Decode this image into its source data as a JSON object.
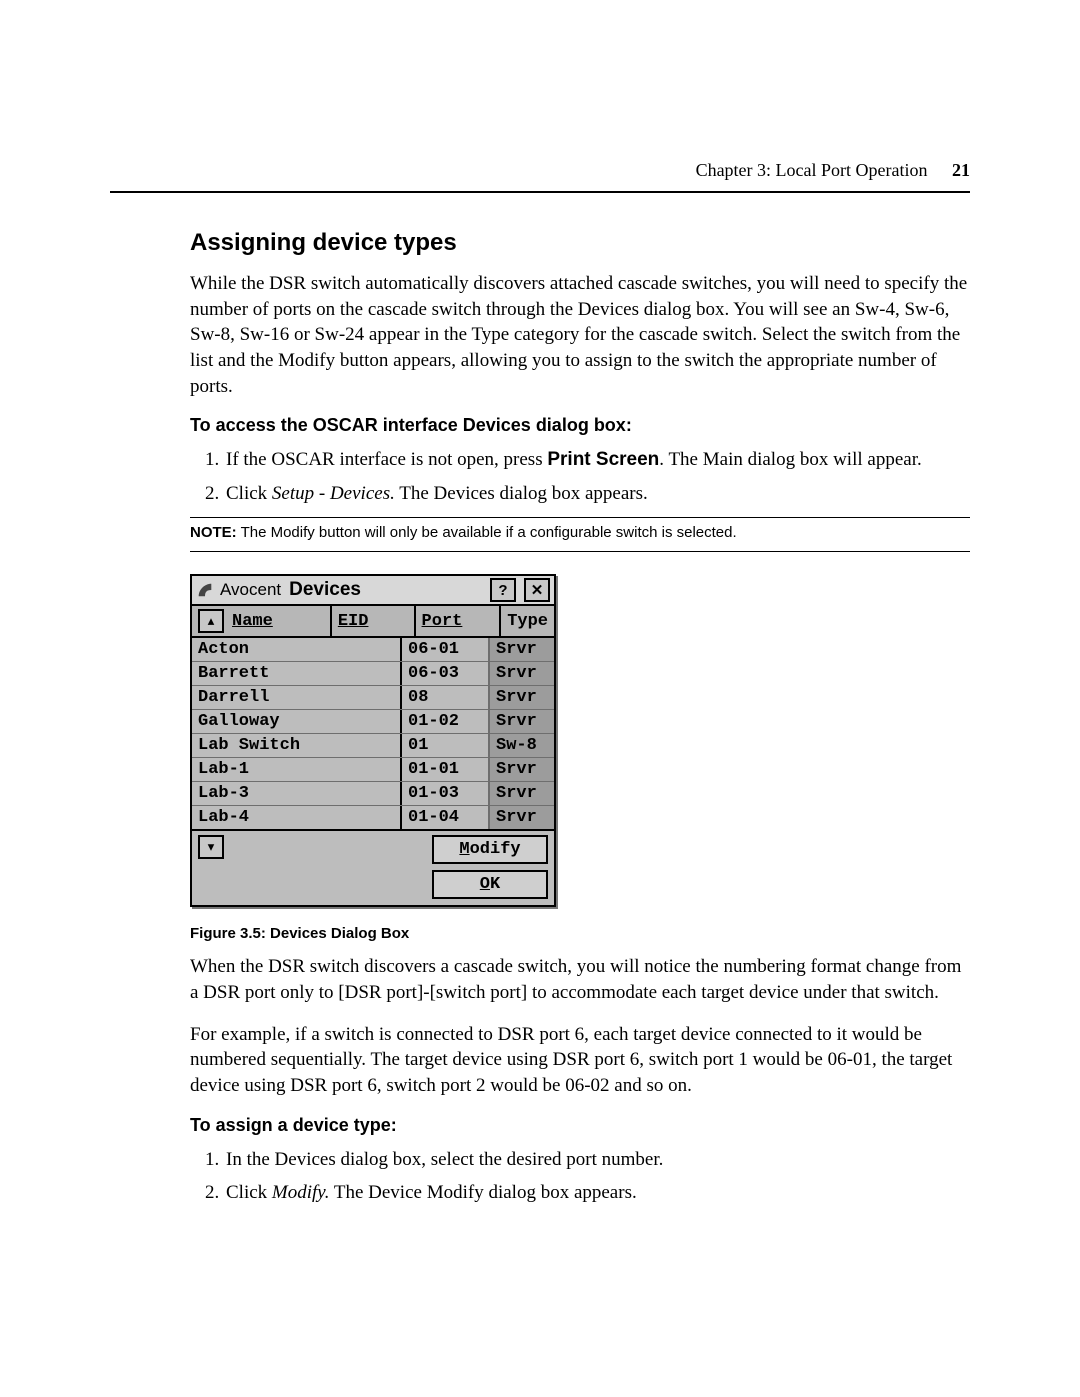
{
  "header": {
    "chapter": "Chapter 3: Local Port Operation",
    "page_number": "21"
  },
  "section_title": "Assigning device types",
  "intro_paragraph": "While the DSR switch automatically discovers attached cascade switches, you will need to specify the number of ports on the cascade switch through the Devices dialog box. You will see an Sw-4, Sw-6, Sw-8, Sw-16 or Sw-24 appear in the Type category for the cascade switch. Select the switch from the list and the Modify button appears, allowing you to assign to the switch the appropriate number of ports.",
  "access_heading": "To access the OSCAR interface Devices dialog box:",
  "access_steps": {
    "s1_pre": "If the OSCAR interface is not open, press ",
    "s1_bold": "Print Screen",
    "s1_post": ". The Main dialog box will appear.",
    "s2_pre": "Click ",
    "s2_italic": "Setup - Devices.",
    "s2_post": " The Devices dialog box appears."
  },
  "note_label": "NOTE:",
  "note_text": " The Modify button will only be available if a configurable switch is selected.",
  "dlg_title_brand": "Avocent",
  "dlg_title_name": "Devices",
  "help_label": "?",
  "close_label": "✕",
  "hdr_name": "Name",
  "hdr_eid": "EID",
  "hdr_port": "Port",
  "hdr_type": "Type",
  "rows": [
    {
      "name": "Acton",
      "port": "06-01",
      "type": "Srvr"
    },
    {
      "name": "Barrett",
      "port": "06-03",
      "type": "Srvr"
    },
    {
      "name": "Darrell",
      "port": "08",
      "type": "Srvr"
    },
    {
      "name": "Galloway",
      "port": "01-02",
      "type": "Srvr"
    },
    {
      "name": "Lab Switch",
      "port": "01",
      "type": "Sw-8"
    },
    {
      "name": "Lab-1",
      "port": "01-01",
      "type": "Srvr"
    },
    {
      "name": "Lab-3",
      "port": "01-03",
      "type": "Srvr"
    },
    {
      "name": "Lab-4",
      "port": "01-04",
      "type": "Srvr"
    }
  ],
  "btn_modify_u": "M",
  "btn_modify_rest": "odify",
  "btn_ok_u": "O",
  "btn_ok_rest": "K",
  "fig_caption": "Figure 3.5: Devices Dialog Box",
  "post_para1": "When the DSR switch discovers a cascade switch, you will notice the numbering format change from a DSR port only to [DSR port]-[switch port] to accommodate each target device under that switch.",
  "post_para2": "For example, if a switch is connected to DSR port 6, each target device connected to it would be numbered sequentially. The target device using DSR port 6, switch port 1 would be 06-01, the target device using DSR port 6, switch port 2 would be 06-02 and so on.",
  "assign_heading": "To assign a device type:",
  "assign_steps": {
    "s1": "In the Devices dialog box, select the desired port number.",
    "s2_pre": "Click ",
    "s2_italic": "Modify.",
    "s2_post": " The Device Modify dialog box appears."
  },
  "sort_up": "▴",
  "sort_down": "▾"
}
